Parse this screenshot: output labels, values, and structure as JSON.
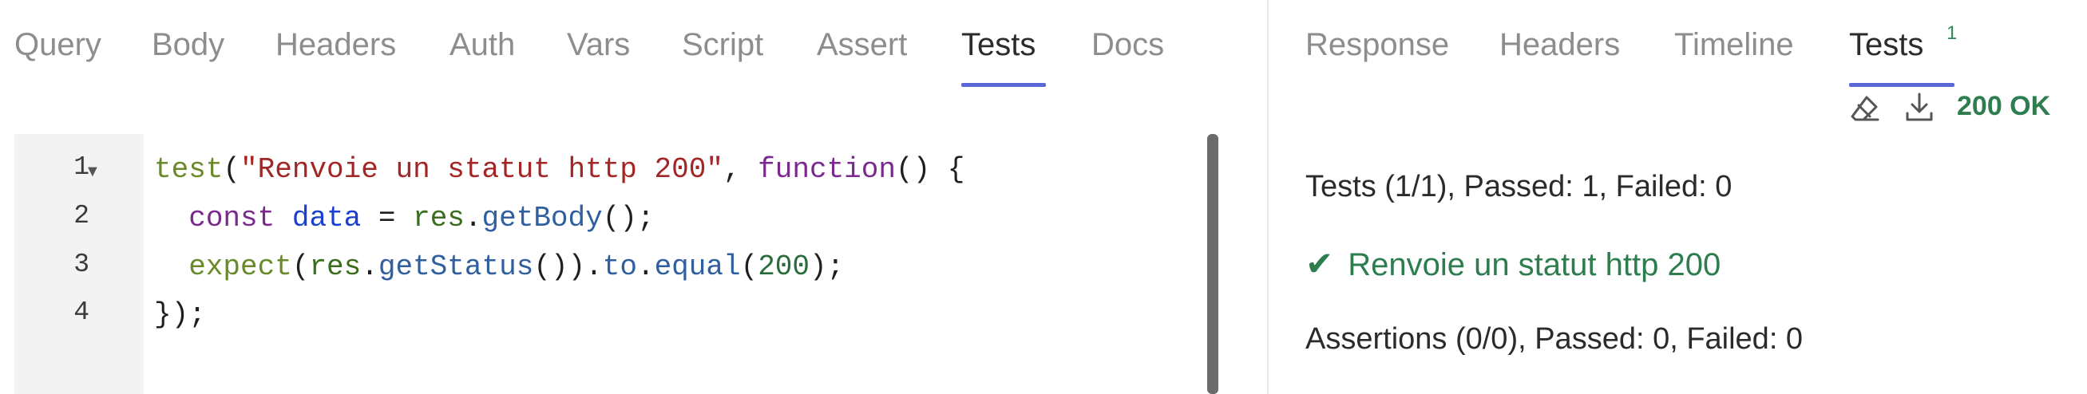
{
  "request_tabs": [
    "Query",
    "Body",
    "Headers",
    "Auth",
    "Vars",
    "Script",
    "Assert",
    "Tests",
    "Docs"
  ],
  "request_active_tab": "Tests",
  "response_tabs": [
    "Response",
    "Headers",
    "Timeline",
    "Tests"
  ],
  "response_active_tab": "Tests",
  "response_tests_badge": "1",
  "status": "200 OK",
  "colors": {
    "accent": "#5b67d6",
    "success": "#2e7d4e"
  },
  "icons": {
    "clear": "eraser-icon",
    "download": "download-icon",
    "fold": "fold-arrow-icon",
    "check": "checkmark-icon"
  },
  "editor": {
    "line_numbers": [
      "1",
      "2",
      "3",
      "4"
    ],
    "lines": [
      [
        {
          "t": "test",
          "c": "k-fn"
        },
        {
          "t": "(",
          "c": "k-p"
        },
        {
          "t": "\"Renvoie un statut http 200\"",
          "c": "k-str"
        },
        {
          "t": ", ",
          "c": "k-p"
        },
        {
          "t": "function",
          "c": "k-kw"
        },
        {
          "t": "() {",
          "c": "k-p"
        }
      ],
      [
        {
          "t": "  ",
          "c": "k-p"
        },
        {
          "t": "const",
          "c": "k-kw"
        },
        {
          "t": " ",
          "c": "k-p"
        },
        {
          "t": "data",
          "c": "k-var"
        },
        {
          "t": " = ",
          "c": "k-p"
        },
        {
          "t": "res",
          "c": "k-id"
        },
        {
          "t": ".",
          "c": "k-p"
        },
        {
          "t": "getBody",
          "c": "k-meth"
        },
        {
          "t": "();",
          "c": "k-p"
        }
      ],
      [
        {
          "t": "  ",
          "c": "k-p"
        },
        {
          "t": "expect",
          "c": "k-fn"
        },
        {
          "t": "(",
          "c": "k-p"
        },
        {
          "t": "res",
          "c": "k-id"
        },
        {
          "t": ".",
          "c": "k-p"
        },
        {
          "t": "getStatus",
          "c": "k-meth"
        },
        {
          "t": "()).",
          "c": "k-p"
        },
        {
          "t": "to",
          "c": "k-meth"
        },
        {
          "t": ".",
          "c": "k-p"
        },
        {
          "t": "equal",
          "c": "k-meth"
        },
        {
          "t": "(",
          "c": "k-p"
        },
        {
          "t": "200",
          "c": "k-num"
        },
        {
          "t": ");",
          "c": "k-p"
        }
      ],
      [
        {
          "t": "});",
          "c": "k-p"
        }
      ]
    ]
  },
  "results": {
    "tests_summary": "Tests (1/1), Passed: 1, Failed: 0",
    "passed_test": "Renvoie un statut http 200",
    "check_glyph": "✔",
    "assertions_summary": "Assertions (0/0), Passed: 0, Failed: 0"
  }
}
